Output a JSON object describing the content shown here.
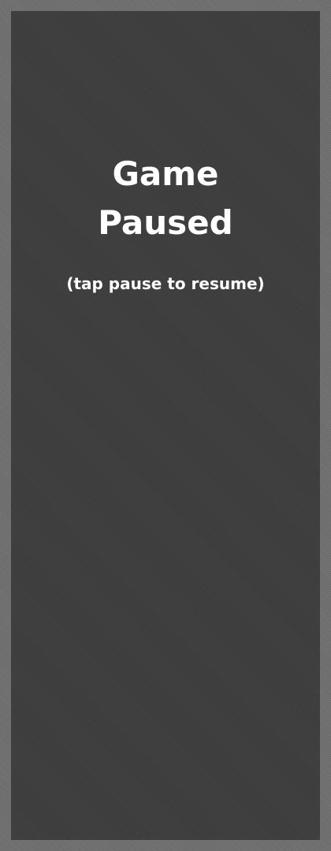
{
  "pause_screen": {
    "title_line_1": "Game",
    "title_line_2": "Paused",
    "hint": "(tap pause to resume)"
  },
  "colors": {
    "frame_border": "#6f6f6f",
    "play_area_background": "#3d3d3d",
    "text": "#ffffff"
  }
}
